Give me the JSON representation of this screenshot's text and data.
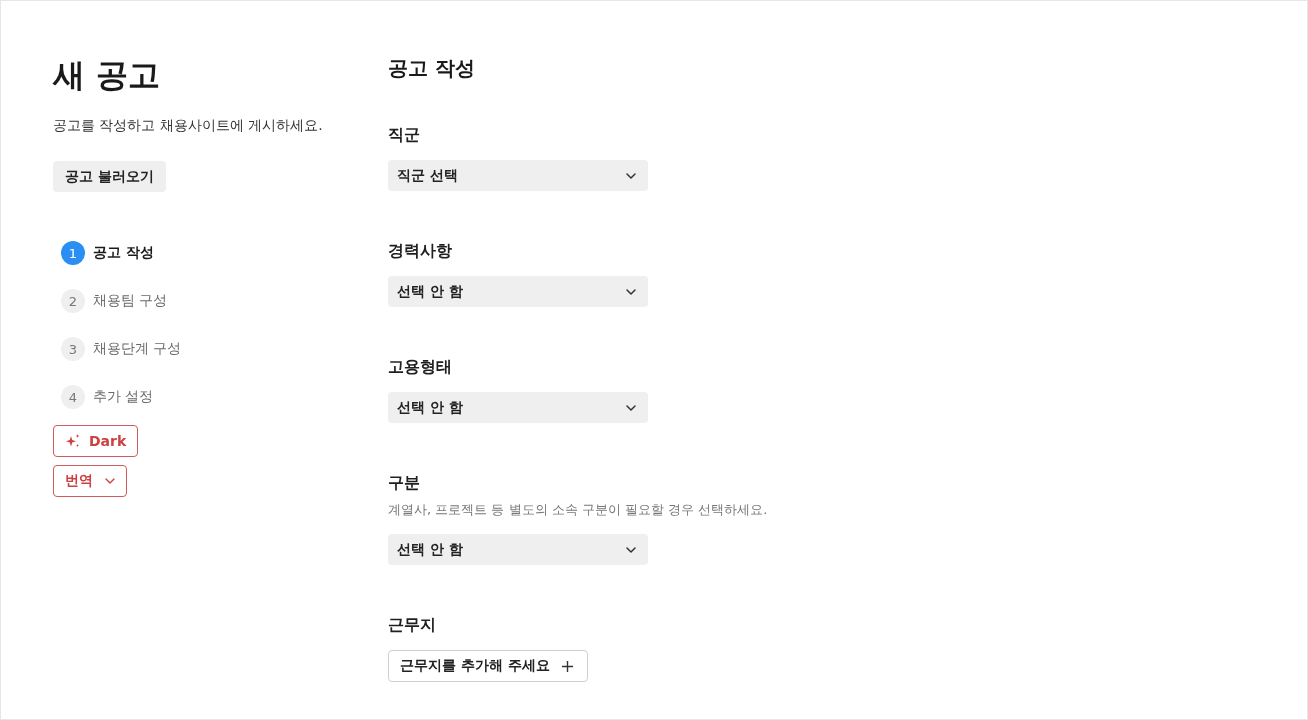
{
  "page": {
    "title": "새 공고",
    "subtitle": "공고를 작성하고 채용사이트에 게시하세요.",
    "load_button": "공고 불러오기"
  },
  "steps": [
    {
      "number": "1",
      "label": "공고 작성",
      "selected": true
    },
    {
      "number": "2",
      "label": "채용팀 구성",
      "selected": false
    },
    {
      "number": "3",
      "label": "채용단계 구성",
      "selected": false
    },
    {
      "number": "4",
      "label": "추가 설정",
      "selected": false
    }
  ],
  "dark_button": {
    "label": "Dark"
  },
  "translate_button": {
    "label": "번역"
  },
  "form": {
    "title": "공고 작성",
    "fields": [
      {
        "kind": "select",
        "label": "직군",
        "value": "직군 선택"
      },
      {
        "kind": "select",
        "label": "경력사항",
        "value": "선택 안 함"
      },
      {
        "kind": "select",
        "label": "고용형태",
        "value": "선택 안 함"
      },
      {
        "kind": "select",
        "label": "구분",
        "description": "계열사, 프로젝트 등 별도의 소속 구분이 필요할 경우 선택하세요.",
        "value": "선택 안 함"
      },
      {
        "kind": "add",
        "label": "근무지",
        "button": "근무지를 추가해 주세요"
      }
    ]
  }
}
